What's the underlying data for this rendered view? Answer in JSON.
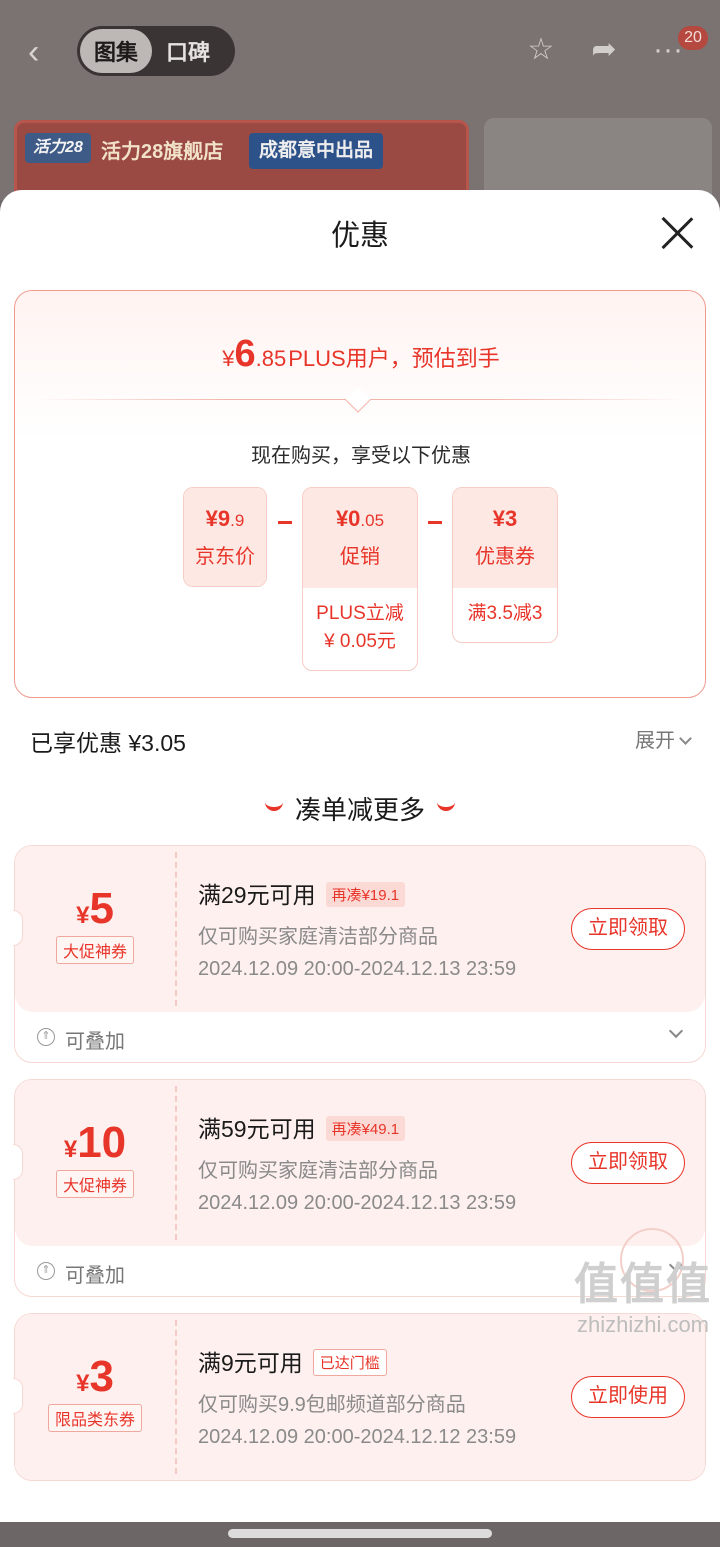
{
  "background": {
    "tabs": [
      "图集",
      "口碑"
    ],
    "badge": "20",
    "banner_logo": "活力28",
    "banner_shop": "活力28旗舰店",
    "banner_tag": "成都意中出品"
  },
  "sheet": {
    "title": "优惠",
    "estimate": {
      "currency": "¥",
      "int": "6",
      "dec": ".85",
      "text": "PLUS用户，预估到手"
    },
    "buy_now": "现在购买，享受以下优惠",
    "breakdown": [
      {
        "amount_int": "¥9",
        "amount_dec": ".9",
        "label": "京东价"
      },
      {
        "amount_int": "¥0",
        "amount_dec": ".05",
        "label": "促销",
        "sub1": "PLUS立减",
        "sub2": "¥ 0.05元"
      },
      {
        "amount_int": "¥3",
        "amount_dec": "",
        "label": "优惠券",
        "sub1": "满3.5减3"
      }
    ],
    "saved": "已享优惠 ¥3.05",
    "expand": "展开",
    "more_title": "凑单减更多"
  },
  "coupons": [
    {
      "currency": "¥",
      "value": "5",
      "type": "大促神券",
      "condition": "满29元可用",
      "pill": "再凑¥19.1",
      "scope": "仅可购买家庭清洁部分商品",
      "time": "2024.12.09 20:00-2024.12.13 23:59",
      "button": "立即领取",
      "stack": "可叠加"
    },
    {
      "currency": "¥",
      "value": "10",
      "type": "大促神券",
      "condition": "满59元可用",
      "pill": "再凑¥49.1",
      "scope": "仅可购买家庭清洁部分商品",
      "time": "2024.12.09 20:00-2024.12.13 23:59",
      "button": "立即领取",
      "stack": "可叠加"
    },
    {
      "currency": "¥",
      "value": "3",
      "type": "限品类东券",
      "condition": "满9元可用",
      "pill": "已达门槛",
      "scope": "仅可购买9.9包邮频道部分商品",
      "time": "2024.12.09 20:00-2024.12.12 23:59",
      "button": "立即使用"
    }
  ],
  "watermark": {
    "big": "值值值",
    "small": "zhizhizhi.com"
  },
  "colors": {
    "accent": "#e8352a",
    "card_bg": "#fdf0ee",
    "muted": "#8a8a8a"
  }
}
